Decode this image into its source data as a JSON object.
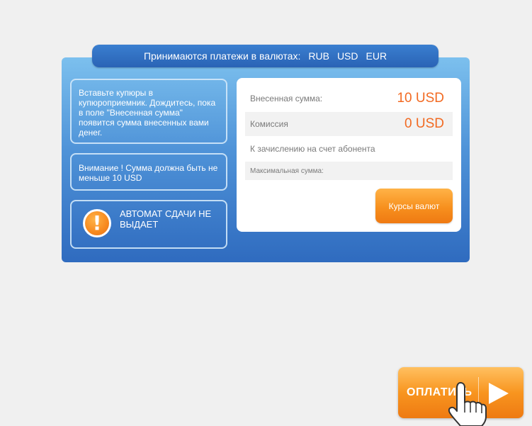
{
  "header": {
    "text": "Принимаются платежи в валютах:",
    "currencies": [
      "RUB",
      "USD",
      "EUR"
    ]
  },
  "info": {
    "instruction": "Вставьте купюры в купюроприемник. Дождитесь, пока в поле \"Внесенная сумма\" появится сумма внесенных вами денег.",
    "minimum": "Внимание ! Сумма должна быть не меньше 10 USD",
    "no_change": "АВТОМАТ СДАЧИ НЕ ВЫДАЕТ",
    "warning_icon": "exclamation-icon"
  },
  "summary": {
    "deposited_label": "Внесенная сумма:",
    "deposited_value": "10 USD",
    "commission_label": "Комиссия",
    "commission_value": "0 USD",
    "credit_label": "К зачислению на счет абонента",
    "max_label": "Максимальная сумма:"
  },
  "buttons": {
    "rates_label": "Курсы валют",
    "pay_label": "ОПЛАТИТЬ"
  },
  "colors": {
    "panel_blue": "#2f6bbf",
    "accent_orange": "#f7901e",
    "value_orange": "#f26a22"
  }
}
